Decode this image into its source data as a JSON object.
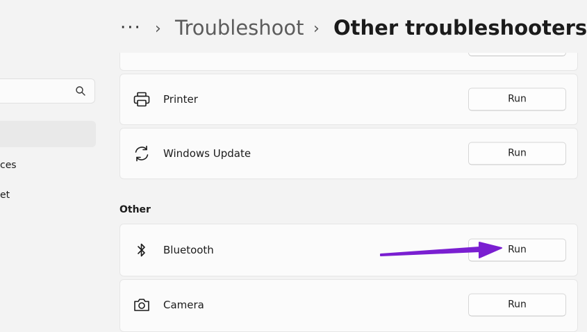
{
  "header": {
    "more": "···",
    "separator": "›",
    "breadcrumb_parent": "Troubleshoot",
    "breadcrumb_current": "Other troubleshooters"
  },
  "sidebar": {
    "items": [
      {
        "label": "ces"
      },
      {
        "label": "et"
      }
    ]
  },
  "cards": [
    {
      "label": "Printer",
      "icon": "printer-icon",
      "button": "Run"
    },
    {
      "label": "Windows Update",
      "icon": "refresh-icon",
      "button": "Run"
    }
  ],
  "other_section": {
    "title": "Other",
    "cards": [
      {
        "label": "Bluetooth",
        "icon": "bluetooth-icon",
        "button": "Run"
      },
      {
        "label": "Camera",
        "icon": "camera-icon",
        "button": "Run"
      }
    ]
  },
  "colors": {
    "background": "#f3f3f3",
    "card": "#fbfbfb",
    "annotation_arrow": "#7a1fd1"
  }
}
